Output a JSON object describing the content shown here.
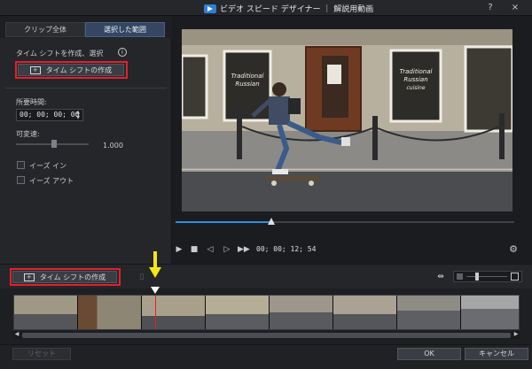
{
  "window": {
    "title": "ビデオ スピード デザイナー ｜ 解説用動画",
    "help_label": "?",
    "close_label": "×"
  },
  "tabs": [
    {
      "label": "クリップ全体",
      "active": false
    },
    {
      "label": "選択した範囲",
      "active": true
    }
  ],
  "left_panel": {
    "instruction": "タイム シフトを作成、選択",
    "info_icon": "i",
    "create_button_label": "タイム シフトの作成",
    "duration_label": "所要時間:",
    "duration_value": "00; 00; 00; 00",
    "speed_label": "可変速:",
    "speed_value": "1.000",
    "speed_level": 0.5,
    "ease_in_label": "イーズ イン",
    "ease_out_label": "イーズ アウト"
  },
  "player": {
    "timecode": "00; 00; 12; 54",
    "scrub_progress": 0.28,
    "controls": [
      "play-icon",
      "stop-icon",
      "prev-frame-icon",
      "next-frame-icon",
      "fast-forward-icon"
    ],
    "sign_text": "Traditional Russian Cuisine",
    "settings_icon": "gear-icon"
  },
  "timeline": {
    "create_button_label": "タイム シフトの作成",
    "zoom_level": 0.3
  },
  "footer": {
    "reset_label": "リセット",
    "ok_label": "OK",
    "cancel_label": "キャンセル"
  },
  "colors": {
    "accent_blue": "#2f8fe0",
    "highlight_red": "#e3202a",
    "arrow_yellow": "#f5e617"
  }
}
